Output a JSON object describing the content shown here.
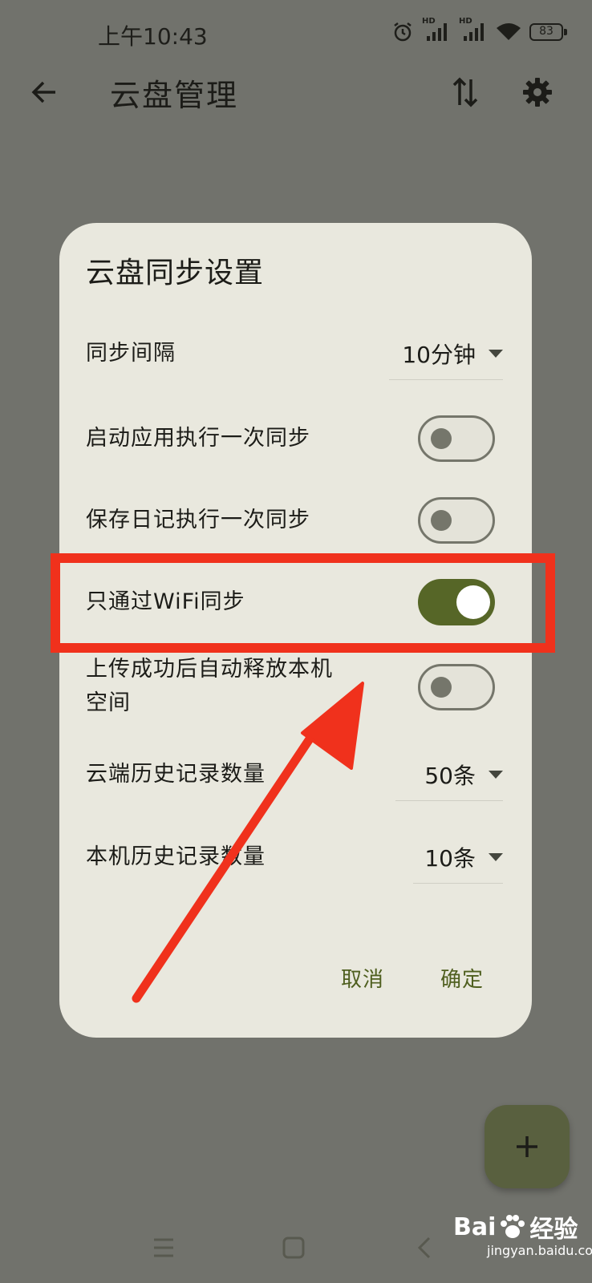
{
  "status_bar": {
    "time": "上午10:43",
    "battery": "83",
    "hd_label": "HD",
    "icons": [
      "alarm-icon",
      "signal-hd-icon",
      "signal-hd-icon",
      "wifi-icon",
      "battery-icon"
    ]
  },
  "app_bar": {
    "title": "云盘管理",
    "icons": [
      "back-arrow-icon",
      "sort-icon",
      "gear-icon"
    ]
  },
  "dialog": {
    "title": "云盘同步设置",
    "sync_interval": {
      "label": "同步间隔",
      "value": "10分钟"
    },
    "sync_on_launch": {
      "label": "启动应用执行一次同步",
      "checked": false
    },
    "sync_on_save": {
      "label": "保存日记执行一次同步",
      "checked": false
    },
    "wifi_only": {
      "label": "只通过WiFi同步",
      "checked": true
    },
    "free_space": {
      "label_line1": "上传成功后自动释放本机",
      "label_line2": "空间",
      "checked": false
    },
    "cloud_history": {
      "label": "云端历史记录数量",
      "value": "50条"
    },
    "local_history": {
      "label": "本机历史记录数量",
      "value": "10条"
    },
    "cancel_label": "取消",
    "confirm_label": "确定"
  },
  "fab": {
    "icon": "plus-icon"
  },
  "nav_bar": {
    "icons": [
      "menu-icon",
      "home-square-icon",
      "back-chevron-icon"
    ]
  },
  "watermark": {
    "brand": "Bai",
    "brand_suffix": "du",
    "product": "经验",
    "url": "jingyan.baidu.com"
  },
  "colors": {
    "scrim": "#71726c",
    "dialog_bg": "#e9e8de",
    "accent": "#566627",
    "action_text": "#4f5f1f",
    "annotation": "#f0311c",
    "fab": "#59603f"
  }
}
